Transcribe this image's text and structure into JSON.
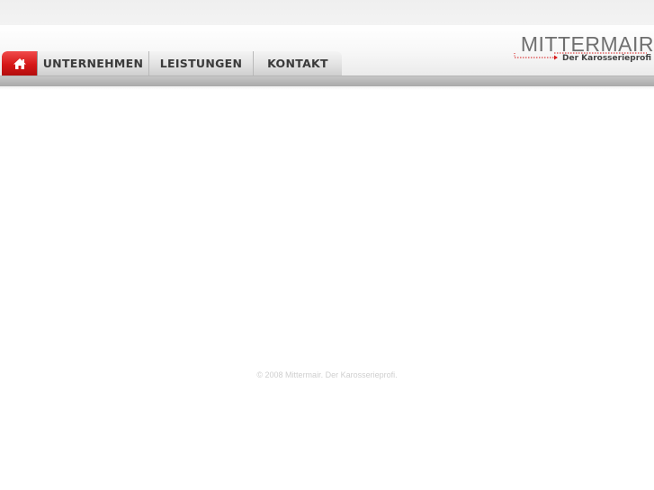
{
  "brand": {
    "name": "MITTERMAIR",
    "tagline": "Der Karosserieprofi",
    "accent_color": "#d61818"
  },
  "nav": {
    "home_icon": "home-icon",
    "items": [
      {
        "label": "UNTERNEHMEN"
      },
      {
        "label": "LEISTUNGEN"
      },
      {
        "label": "KONTAKT"
      }
    ]
  },
  "footer": {
    "copyright": "© 2008 Mittermair. Der Karosserieprofi."
  }
}
